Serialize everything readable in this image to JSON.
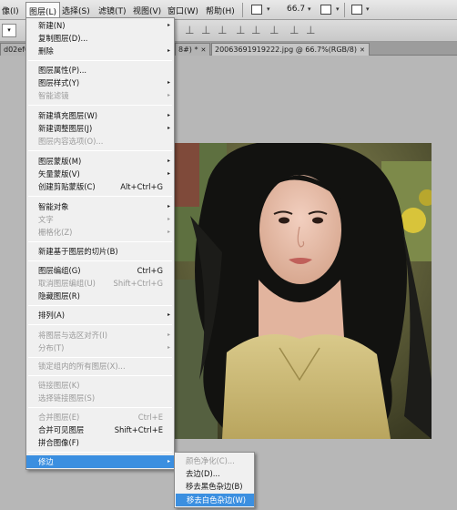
{
  "menubar": {
    "items": [
      "像(I)",
      "图层(L)",
      "选择(S)",
      "滤镜(T)",
      "视图(V)",
      "窗口(W)",
      "帮助(H)"
    ],
    "zoom": "66.7",
    "dropdown_glyph": "▾"
  },
  "tabs": [
    {
      "label": "d02ef0",
      "close": ""
    },
    {
      "label": "8#) *",
      "close": "✕"
    },
    {
      "label": "20063691919222.jpg @ 66.7%(RGB/8)",
      "close": "✕"
    }
  ],
  "layer_menu": {
    "items": [
      {
        "label": "新建(N)",
        "shortcut": "",
        "arrow": "▸",
        "disabled": false
      },
      {
        "label": "复制图层(D)...",
        "shortcut": "",
        "arrow": "",
        "disabled": false
      },
      {
        "label": "删除",
        "shortcut": "",
        "arrow": "▸",
        "disabled": false
      },
      {
        "label": "图层属性(P)...",
        "shortcut": "",
        "arrow": "",
        "disabled": false
      },
      {
        "label": "图层样式(Y)",
        "shortcut": "",
        "arrow": "▸",
        "disabled": false
      },
      {
        "label": "智能滤镜",
        "shortcut": "",
        "arrow": "▸",
        "disabled": true
      },
      {
        "label": "新建填充图层(W)",
        "shortcut": "",
        "arrow": "▸",
        "disabled": false
      },
      {
        "label": "新建调整图层(J)",
        "shortcut": "",
        "arrow": "▸",
        "disabled": false
      },
      {
        "label": "图层内容选项(O)...",
        "shortcut": "",
        "arrow": "",
        "disabled": true
      },
      {
        "label": "图层蒙版(M)",
        "shortcut": "",
        "arrow": "▸",
        "disabled": false
      },
      {
        "label": "矢量蒙版(V)",
        "shortcut": "",
        "arrow": "▸",
        "disabled": false
      },
      {
        "label": "创建剪贴蒙版(C)",
        "shortcut": "Alt+Ctrl+G",
        "arrow": "",
        "disabled": false
      },
      {
        "label": "智能对象",
        "shortcut": "",
        "arrow": "▸",
        "disabled": false
      },
      {
        "label": "文字",
        "shortcut": "",
        "arrow": "▸",
        "disabled": true
      },
      {
        "label": "栅格化(Z)",
        "shortcut": "",
        "arrow": "▸",
        "disabled": true
      },
      {
        "label": "新建基于图层的切片(B)",
        "shortcut": "",
        "arrow": "",
        "disabled": false
      },
      {
        "label": "图层编组(G)",
        "shortcut": "Ctrl+G",
        "arrow": "",
        "disabled": false
      },
      {
        "label": "取消图层编组(U)",
        "shortcut": "Shift+Ctrl+G",
        "arrow": "",
        "disabled": true
      },
      {
        "label": "隐藏图层(R)",
        "shortcut": "",
        "arrow": "",
        "disabled": false
      },
      {
        "label": "排列(A)",
        "shortcut": "",
        "arrow": "▸",
        "disabled": false
      },
      {
        "label": "将图层与选区对齐(I)",
        "shortcut": "",
        "arrow": "▸",
        "disabled": true
      },
      {
        "label": "分布(T)",
        "shortcut": "",
        "arrow": "▸",
        "disabled": true
      },
      {
        "label": "锁定组内的所有图层(X)...",
        "shortcut": "",
        "arrow": "",
        "disabled": true
      },
      {
        "label": "链接图层(K)",
        "shortcut": "",
        "arrow": "",
        "disabled": true
      },
      {
        "label": "选择链接图层(S)",
        "shortcut": "",
        "arrow": "",
        "disabled": true
      },
      {
        "label": "合并图层(E)",
        "shortcut": "Ctrl+E",
        "arrow": "",
        "disabled": true
      },
      {
        "label": "合并可见图层",
        "shortcut": "Shift+Ctrl+E",
        "arrow": "",
        "disabled": false
      },
      {
        "label": "拼合图像(F)",
        "shortcut": "",
        "arrow": "",
        "disabled": false
      },
      {
        "label": "修边",
        "shortcut": "",
        "arrow": "▸",
        "disabled": false,
        "highlighted": true
      }
    ]
  },
  "matting_submenu": {
    "items": [
      {
        "label": "颜色净化(C)...",
        "disabled": true
      },
      {
        "label": "去边(D)...",
        "disabled": false
      },
      {
        "label": "移去黑色杂边(B)",
        "disabled": false
      },
      {
        "label": "移去白色杂边(W)",
        "disabled": false,
        "highlighted": true
      }
    ]
  },
  "colors": {
    "highlight": "#3b8fe0",
    "menu_bg": "#f0f0f0",
    "canvas_bg": "#b7b7b7"
  }
}
